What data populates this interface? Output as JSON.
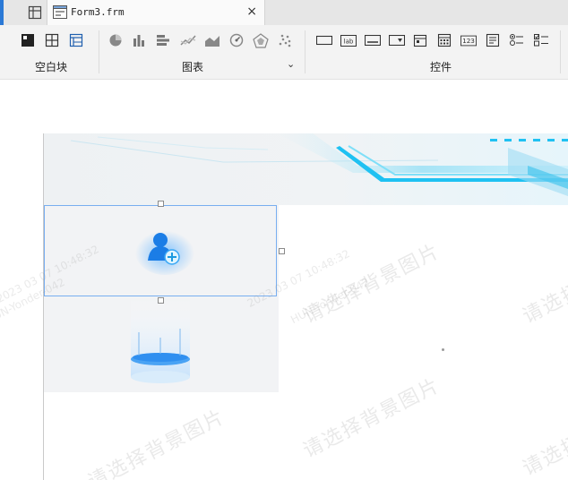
{
  "tabbar": {
    "file_tab_label": "Form3.frm",
    "close_glyph": "×"
  },
  "ribbon": {
    "groups": [
      {
        "label": "空白块",
        "tools": [
          "absolute-block-icon",
          "split-layout-icon",
          "table-layout-icon"
        ]
      },
      {
        "label": "图表",
        "tools": [
          "pie-chart-icon",
          "bar-chart-icon",
          "horizontal-bar-chart-icon",
          "line-chart-icon",
          "area-chart-icon",
          "gauge-chart-icon",
          "radar-chart-icon",
          "scatter-chart-icon"
        ]
      },
      {
        "label": "控件",
        "tools": [
          "label-control-icon",
          "label-text-icon",
          "button-control-icon",
          "combobox-control-icon",
          "date-control-icon",
          "calendar-control-icon",
          "number-control-icon",
          "textarea-control-icon",
          "radio-group-icon",
          "checkbox-group-icon"
        ]
      }
    ],
    "tool_text": {
      "lab": "lab",
      "num": "123"
    },
    "chart_group_expand_glyph": "⌄"
  },
  "canvas": {
    "watermark_text": "请选择背景图片",
    "faint_watermark_lines": [
      "2023 03 07 10:48:32",
      "HUN-Yonder-042"
    ]
  },
  "colors": {
    "accent_blue": "#2b79d6",
    "selection_border": "#78aef0",
    "banner_cyan": "#1fc1f2"
  }
}
